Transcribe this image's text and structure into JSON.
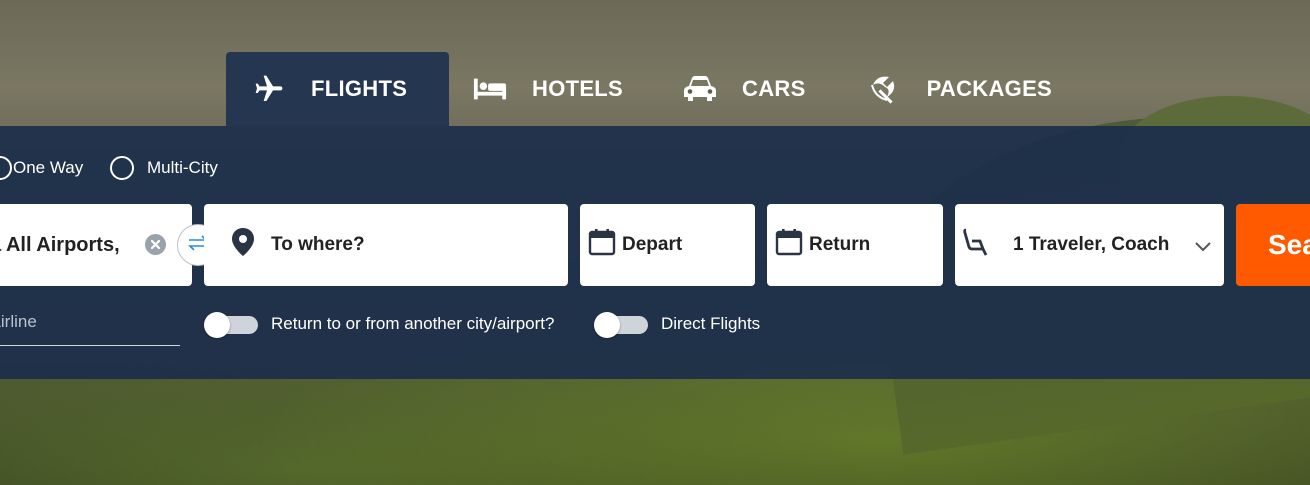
{
  "tabs": [
    {
      "label": "FLIGHTS",
      "icon": "airplane-icon",
      "active": true
    },
    {
      "label": "HOTELS",
      "icon": "bed-icon",
      "active": false
    },
    {
      "label": "CARS",
      "icon": "car-icon",
      "active": false
    },
    {
      "label": "PACKAGES",
      "icon": "beach-umbrella-icon",
      "active": false
    }
  ],
  "trip_type": {
    "one_way_label": "One Way",
    "multi_city_label": "Multi-City"
  },
  "search": {
    "from_value": "a All Airports,",
    "to_placeholder": "To where?",
    "depart_label": "Depart",
    "return_label": "Return",
    "travelers_value": "1 Traveler, Coach",
    "search_button_label": "Sea"
  },
  "options": {
    "airline_placeholder": "l Airline",
    "return_other_city_label": "Return to or from another city/airport?",
    "direct_flights_label": "Direct Flights"
  },
  "colors": {
    "panel": "#1c2e4a",
    "active_tab": "#253650",
    "search_button": "#ff5a00",
    "swap_icon": "#2a8bd6"
  }
}
